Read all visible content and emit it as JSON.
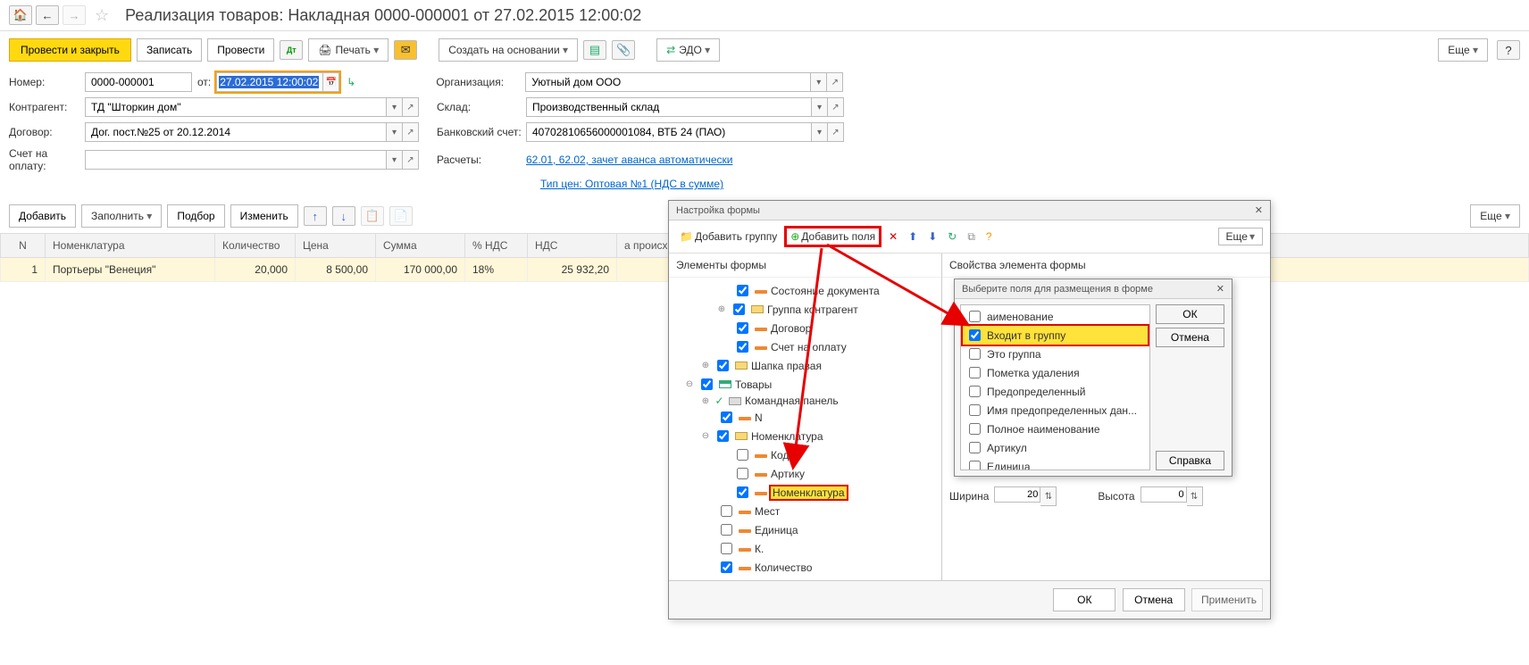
{
  "header": {
    "title": "Реализация товаров: Накладная 0000-000001 от 27.02.2015 12:00:02"
  },
  "cmdbar": {
    "post_close": "Провести и закрыть",
    "save": "Записать",
    "post": "Провести",
    "print": "Печать",
    "create_based": "Создать на основании",
    "edi": "ЭДО",
    "more": "Еще"
  },
  "form": {
    "number_label": "Номер:",
    "number_value": "0000-000001",
    "from_label": "от:",
    "date_value": "27.02.2015 12:00:02",
    "org_label": "Организация:",
    "org_value": "Уютный дом ООО",
    "partner_label": "Контрагент:",
    "partner_value": "ТД \"Шторкин дом\"",
    "warehouse_label": "Склад:",
    "warehouse_value": "Производственный склад",
    "contract_label": "Договор:",
    "contract_value": "Дог. пост.№25 от 20.12.2014",
    "bank_label": "Банковский счет:",
    "bank_value": "40702810656000001084, ВТБ 24 (ПАО)",
    "invoice_label": "Счет на оплату:",
    "calc_label": "Расчеты:",
    "calc_link": "62.01, 62.02, зачет аванса автоматически",
    "price_link": "Тип цен: Оптовая №1 (НДС в сумме)"
  },
  "tbl_toolbar": {
    "add": "Добавить",
    "fill": "Заполнить",
    "pick": "Подбор",
    "change": "Изменить",
    "more": "Еще"
  },
  "table": {
    "cols": [
      "N",
      "Номенклатура",
      "Количество",
      "Цена",
      "Сумма",
      "% НДС",
      "НДС",
      "а происхождения"
    ],
    "row": {
      "n": "1",
      "item": "Портьеры \"Венеция\"",
      "qty": "20,000",
      "price": "8 500,00",
      "sum": "170 000,00",
      "vat_rate": "18%",
      "vat": "25 932,20"
    }
  },
  "dlg": {
    "title": "Настройка формы",
    "add_group": "Добавить группу",
    "add_fields": "Добавить поля",
    "more": "Еще",
    "left_header": "Элементы формы",
    "right_header": "Свойства элемента формы",
    "tree": {
      "status": "Состояние документа",
      "partner_group": "Группа контрагент",
      "contract": "Договор",
      "invoice": "Счет на оплату",
      "header_right": "Шапка правая",
      "goods": "Товары",
      "cmd_panel": "Командная панель",
      "n": "N",
      "nomenclature": "Номенклатура",
      "code": "Код",
      "article": "Артику",
      "nomenclature_inner": "Номенклатура",
      "places": "Мест",
      "unit": "Единица",
      "k": "К.",
      "qty": "Количество"
    },
    "width_label": "Ширина",
    "width_value": "20",
    "height_label": "Высота",
    "height_value": "0",
    "ok": "ОК",
    "cancel": "Отмена",
    "apply": "Применить"
  },
  "dlg2": {
    "title": "Выберите поля для размещения в форме",
    "items": [
      "аименование",
      "Входит в группу",
      "Это группа",
      "Пометка удаления",
      "Предопределенный",
      "Имя предопределенных дан...",
      "Полное наименование",
      "Артикул",
      "Единица"
    ],
    "ok": "ОК",
    "cancel": "Отмена",
    "help": "Справка"
  }
}
